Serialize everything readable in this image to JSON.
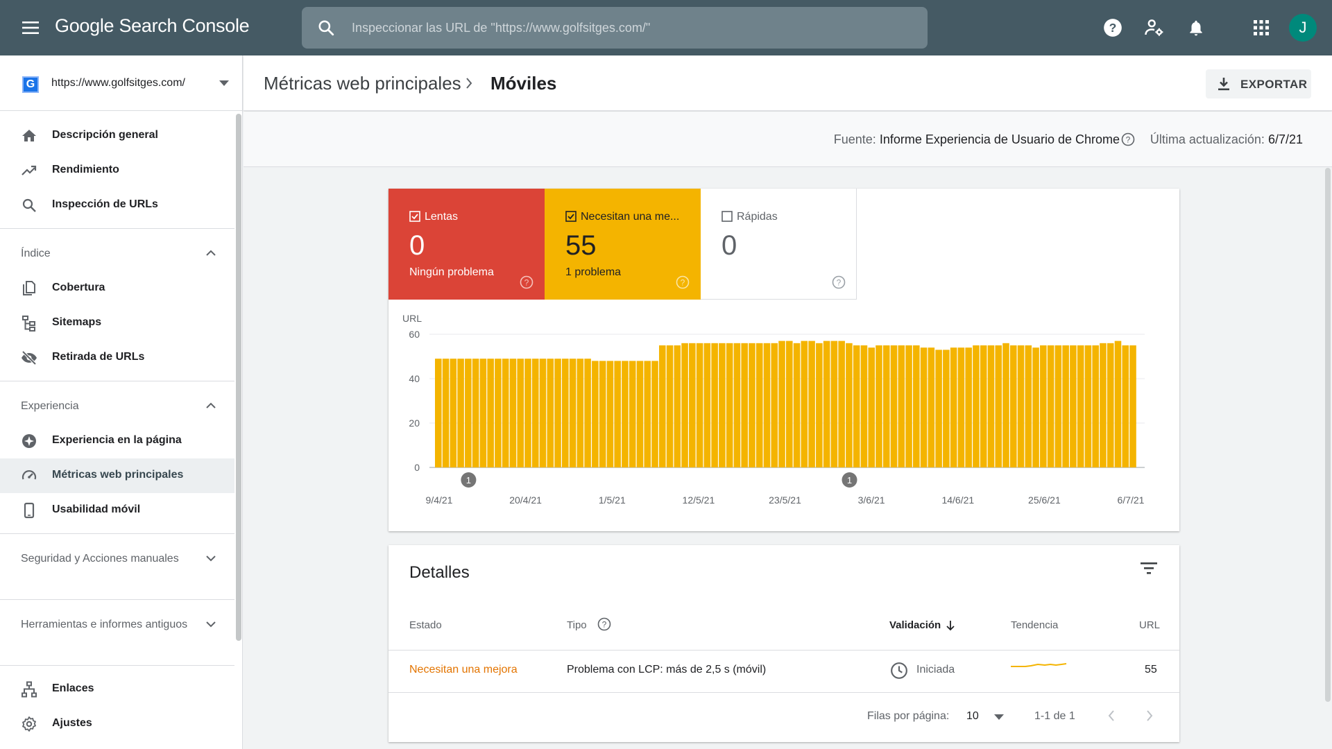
{
  "app": {
    "title": "Google Search Console"
  },
  "search": {
    "placeholder": "Inspeccionar las URL de \"https://www.golfsitges.com/\""
  },
  "user": {
    "initial": "J"
  },
  "property": {
    "url": "https://www.golfsitges.com/",
    "favicon_letter": "G"
  },
  "sidebar": {
    "top_items": [
      {
        "label": "Descripción general",
        "icon": "home-icon"
      },
      {
        "label": "Rendimiento",
        "icon": "trending-up-icon"
      },
      {
        "label": "Inspección de URLs",
        "icon": "search-icon"
      }
    ],
    "sections": [
      {
        "title": "Índice",
        "expanded": true,
        "items": [
          {
            "label": "Cobertura",
            "icon": "copy-icon"
          },
          {
            "label": "Sitemaps",
            "icon": "sitemap-icon"
          },
          {
            "label": "Retirada de URLs",
            "icon": "eye-off-icon"
          }
        ]
      },
      {
        "title": "Experiencia",
        "expanded": true,
        "items": [
          {
            "label": "Experiencia en la página",
            "icon": "plus-circle-icon"
          },
          {
            "label": "Métricas web principales",
            "icon": "speedometer-icon",
            "active": true
          },
          {
            "label": "Usabilidad móvil",
            "icon": "phone-icon"
          }
        ]
      },
      {
        "title": "Seguridad y Acciones manuales",
        "expanded": false
      },
      {
        "title": "Herramientas e informes antiguos",
        "expanded": false
      }
    ],
    "bottom_items": [
      {
        "label": "Enlaces",
        "icon": "links-icon"
      },
      {
        "label": "Ajustes",
        "icon": "gear-icon"
      }
    ]
  },
  "header": {
    "breadcrumb_parent": "Métricas web principales",
    "breadcrumb_current": "Móviles",
    "export_label": "EXPORTAR"
  },
  "source": {
    "label": "Fuente:",
    "value": "Informe Experiencia de Usuario de Chrome",
    "updated_label": "Última actualización:",
    "updated_value": "6/7/21"
  },
  "tiles": {
    "poor": {
      "label": "Lentas",
      "value": "0",
      "sub": "Ningún problema",
      "checked": true,
      "color": "#db4437"
    },
    "needs_improvement": {
      "label": "Necesitan una me...",
      "value": "55",
      "sub": "1 problema",
      "checked": true,
      "color": "#f4b400"
    },
    "good": {
      "label": "Rápidas",
      "value": "0",
      "sub": "",
      "checked": false
    }
  },
  "chart_data": {
    "type": "bar",
    "ylabel": "URL",
    "ylim": [
      0,
      60
    ],
    "yticks": [
      0,
      20,
      40,
      60
    ],
    "xtick_labels": [
      "9/4/21",
      "20/4/21",
      "1/5/21",
      "12/5/21",
      "23/5/21",
      "3/6/21",
      "14/6/21",
      "25/6/21",
      "6/7/21"
    ],
    "annotations": [
      {
        "label": "1",
        "bar_index": 4
      },
      {
        "label": "1",
        "bar_index": 55
      }
    ],
    "series": [
      {
        "name": "Necesitan una mejora",
        "color": "#f4b400",
        "values": [
          49,
          49,
          49,
          49,
          49,
          49,
          49,
          49,
          49,
          49,
          49,
          49,
          49,
          49,
          49,
          49,
          49,
          49,
          49,
          49,
          49,
          48,
          48,
          48,
          48,
          48,
          48,
          48,
          48,
          48,
          55,
          55,
          55,
          56,
          56,
          56,
          56,
          56,
          56,
          56,
          56,
          56,
          56,
          56,
          56,
          56,
          57,
          57,
          56,
          57,
          57,
          56,
          57,
          57,
          57,
          56,
          55,
          55,
          54,
          55,
          55,
          55,
          55,
          55,
          55,
          54,
          54,
          53,
          53,
          54,
          54,
          54,
          55,
          55,
          55,
          55,
          56,
          55,
          55,
          55,
          54,
          55,
          55,
          55,
          55,
          55,
          55,
          55,
          55,
          56,
          56,
          57,
          55,
          55
        ]
      }
    ]
  },
  "details": {
    "title": "Detalles",
    "columns": {
      "estado": "Estado",
      "tipo": "Tipo",
      "validacion": "Validación",
      "tendencia": "Tendencia",
      "url": "URL"
    },
    "rows": [
      {
        "estado": "Necesitan una mejora",
        "tipo": "Problema con LCP: más de 2,5 s (móvil)",
        "validacion": "Iniciada",
        "url": "55"
      }
    ],
    "pager": {
      "rows_label": "Filas por página:",
      "rows_value": "10",
      "range": "1-1 de 1"
    }
  }
}
